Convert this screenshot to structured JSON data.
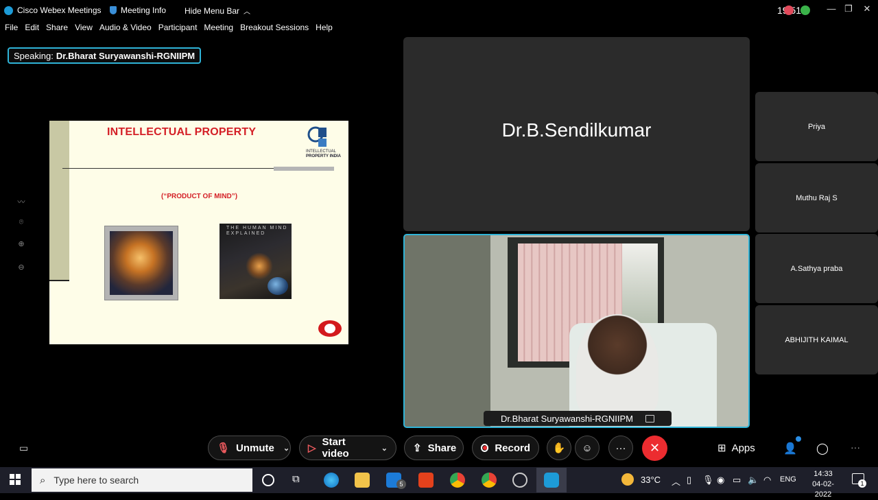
{
  "titlebar": {
    "app_title": "Cisco Webex Meetings",
    "meeting_info": "Meeting Info",
    "hide_menu_bar": "Hide Menu Bar",
    "clock": "19:51"
  },
  "menu": [
    "File",
    "Edit",
    "Share",
    "View",
    "Audio & Video",
    "Participant",
    "Meeting",
    "Breakout Sessions",
    "Help"
  ],
  "speaking": {
    "prefix": "Speaking:",
    "name": "Dr.Bharat Suryawanshi-RGNIIPM"
  },
  "slide": {
    "title": "INTELLECTUAL PROPERTY",
    "subtitle": "(“PRODUCT OF MIND”)",
    "logo_line1": "INTELLECTUAL",
    "logo_line2": "PROPERTY INDIA",
    "book_title_1": "THE HUMAN MIND",
    "book_title_2": "EXPLAINED"
  },
  "tiles": {
    "main_name": "Dr.B.Sendilkumar",
    "camera_label": "Dr.Bharat Suryawanshi-RGNIIPM",
    "participants": [
      "Priya",
      "Muthu Raj S",
      "A.Sathya praba",
      "ABHIJITH KAIMAL"
    ]
  },
  "controls": {
    "unmute": "Unmute",
    "start_video": "Start video",
    "share": "Share",
    "record": "Record",
    "more": "···",
    "apps": "Apps"
  },
  "taskbar": {
    "search_placeholder": "Type here to search",
    "mail_badge": "5",
    "weather": "33°C",
    "lang": "ENG",
    "time": "14:33",
    "date": "04-02-2022",
    "notif": "1"
  },
  "colors": {
    "accent": "#2fb4d8",
    "leave": "#ec2c30",
    "slide_red": "#d41f26"
  }
}
